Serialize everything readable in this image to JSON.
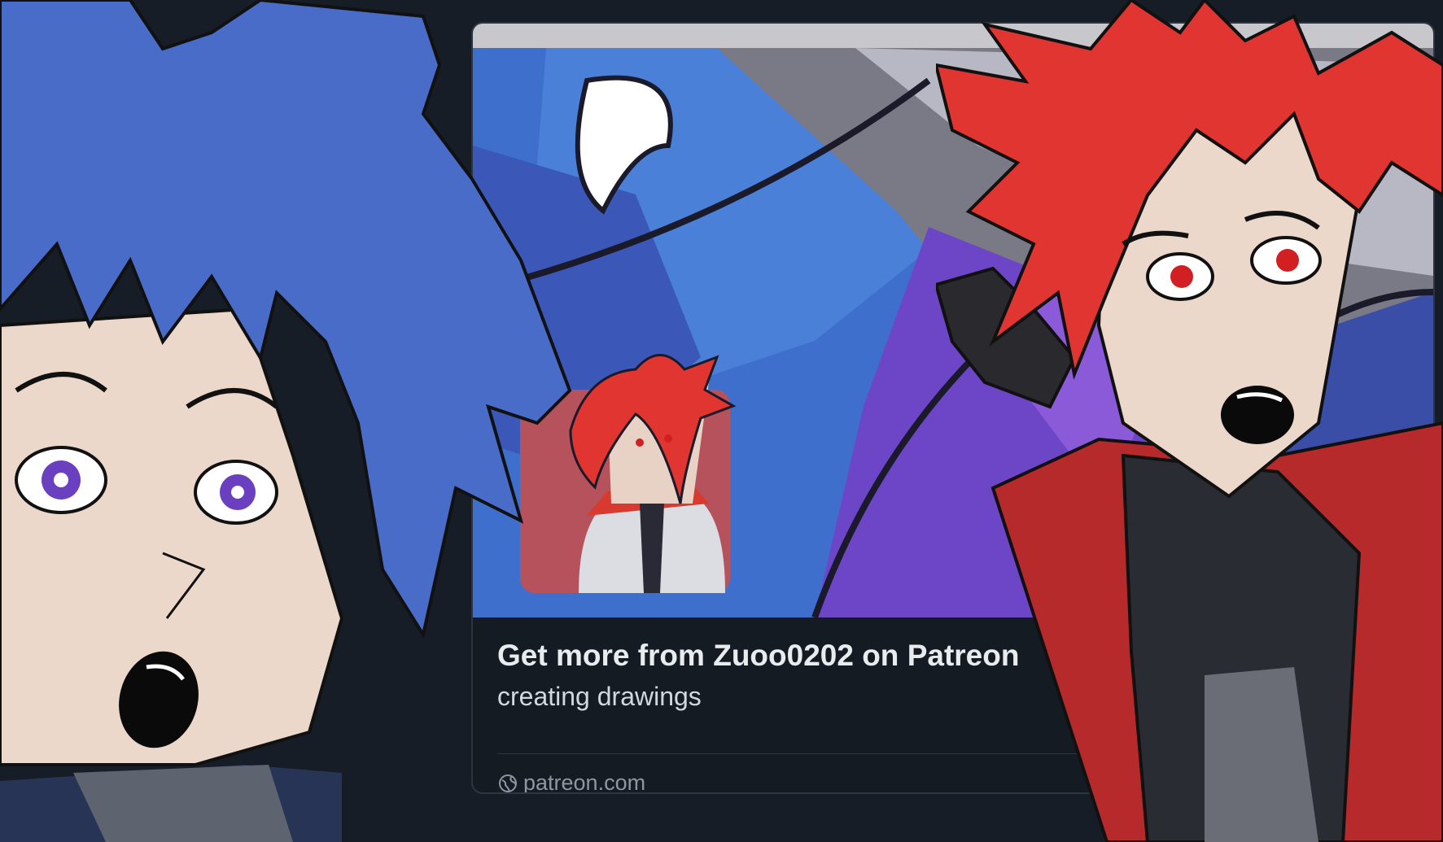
{
  "link_card": {
    "title": "Get more from Zuoo0202 on Patreon",
    "description": "creating drawings",
    "domain": "patreon.com",
    "domain_icon": "globe-icon"
  },
  "colors": {
    "background": "#161d26",
    "card_background": "#151b23",
    "card_border": "#2c3540",
    "title_text": "#e9ecef",
    "domain_text": "#8d97a3",
    "blue_hair": "#4a6cc9",
    "red_hair": "#e03530",
    "skin": "#ecd7cb",
    "avatar_background": "#b5525c"
  }
}
